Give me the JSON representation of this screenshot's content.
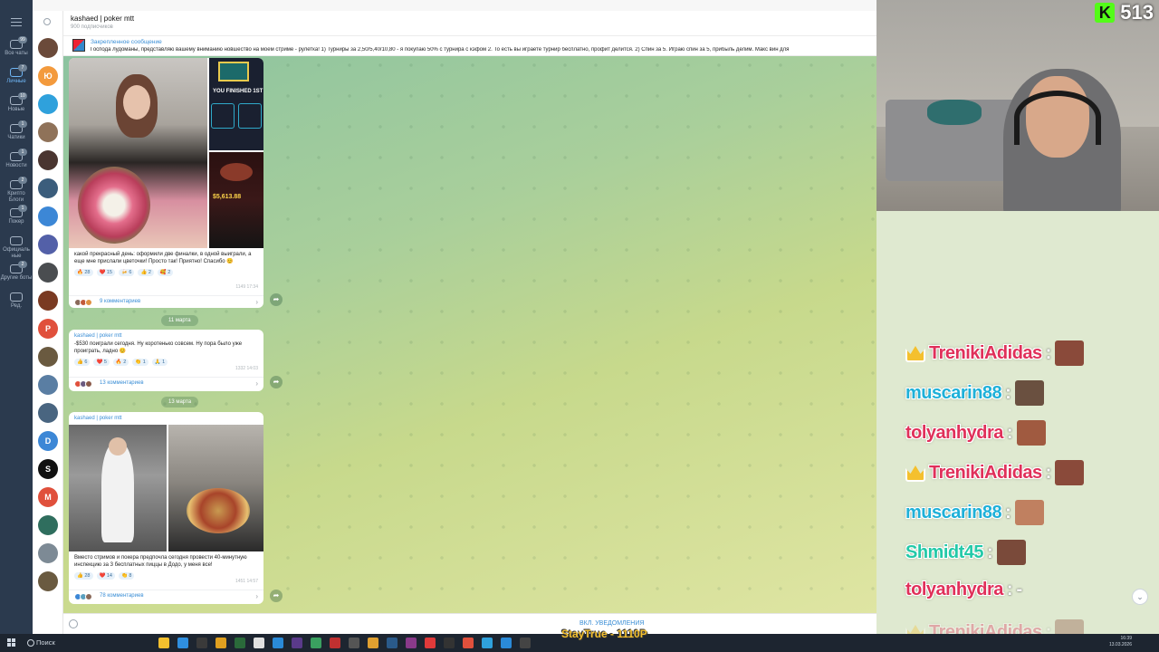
{
  "folders": {
    "items": [
      {
        "label": "Все чаты",
        "badge": "99"
      },
      {
        "label": "Личные",
        "badge": "7"
      },
      {
        "label": "Новые",
        "badge": "10"
      },
      {
        "label": "Чатики",
        "badge": "1"
      },
      {
        "label": "Новости",
        "badge": "1"
      },
      {
        "label": "Крипто Блоги",
        "badge": "2"
      },
      {
        "label": "Покер",
        "badge": "1"
      },
      {
        "label": "Официаль ные",
        "badge": ""
      },
      {
        "label": "Другие боты",
        "badge": "2"
      },
      {
        "label": "Ред.",
        "badge": ""
      }
    ]
  },
  "chatlist": {
    "avatars": [
      {
        "letter": "",
        "color": "#6b4a3a"
      },
      {
        "letter": "Ю",
        "color": "#f39a3d"
      },
      {
        "letter": "",
        "color": "#2fa1dc"
      },
      {
        "letter": "",
        "color": "#8f7259"
      },
      {
        "letter": "",
        "color": "#4a3530"
      },
      {
        "letter": "",
        "color": "#3b5d7c"
      },
      {
        "letter": "",
        "color": "#3c87d6"
      },
      {
        "letter": "",
        "color": "#5360a8"
      },
      {
        "letter": "",
        "color": "#4a4d50"
      },
      {
        "letter": "",
        "color": "#7a3a22"
      },
      {
        "letter": "P",
        "color": "#e0503c"
      },
      {
        "letter": "",
        "color": "#6a5a40"
      },
      {
        "letter": "",
        "color": "#5a7ea3"
      },
      {
        "letter": "",
        "color": "#496580"
      },
      {
        "letter": "D",
        "color": "#3c87d6"
      },
      {
        "letter": "S",
        "color": "#111111"
      },
      {
        "letter": "M",
        "color": "#e0503c"
      },
      {
        "letter": "",
        "color": "#2f6e5e"
      },
      {
        "letter": "",
        "color": "#7d8a95"
      },
      {
        "letter": "",
        "color": "#6a5a40"
      }
    ]
  },
  "header": {
    "title": "kashaed | poker mtt",
    "subscribers": "900 подписчиков"
  },
  "pinned": {
    "label": "Закрепленное сообщение",
    "text": "Господа лудоманы, представляю вашему вниманию новшество на моем стриме - рулетка! 1) Турниры за 2,50/5,40/10,80 - я покупаю 50% с турнира с кэфом 2. То есть вы играете турнир бесплатно, профит делится. 2) Спин за 5. Играю спин за 5, прибыль делим. Макс вин для"
  },
  "messages": [
    {
      "author": "",
      "text": "какой прекрасный день: оформили две финалки, в одной выиграли, а еще мне прислали цветочки! Просто так! Приятно! Спасибо 😊",
      "reactions": [
        "🔥 28",
        "❤️ 15",
        "🍻 6",
        "👍 2",
        "🥰 2"
      ],
      "views": "1149  17:34",
      "comments": "9 комментариев",
      "poster_title": "YOU FINISHED 1ST",
      "poster_amount": "$5,613.88"
    },
    {
      "author": "kashaed | poker mtt",
      "text": "-$530 поиграли сегодня. Ну коротенько совсем. Ну пора было уже проиграть, ладно 😊",
      "reactions": [
        "👍 6",
        "❤️ 5",
        "🔥 2",
        "👏 1",
        "🙏 1"
      ],
      "views": "1332  14:03",
      "comments": "13 комментариев"
    },
    {
      "author": "kashaed | poker mtt",
      "text": "Вместо стримов и покера предпочла сегодня провести 40-минутную инспекцию за 3 бесплатных пиццы в Додо, у меня все!",
      "reactions": [
        "👍 28",
        "❤️ 14",
        "👏 8"
      ],
      "views": "1451  14:57",
      "comments": "78 комментариев"
    }
  ],
  "dates": [
    "11 марта",
    "13 марта"
  ],
  "composer": {
    "notif_label": "ВКЛ. УВЕДОМЛЕНИЯ"
  },
  "kick": {
    "count": "513"
  },
  "stream_chat": [
    {
      "name": "TrenikiAdidas",
      "color": "#e0305a",
      "crown": true,
      "emote_color": "#8a4a3a",
      "text": ""
    },
    {
      "name": "muscarin88",
      "color": "#1eb0d8",
      "crown": false,
      "emote_color": "#6a5040",
      "text": ""
    },
    {
      "name": "tolyanhydra",
      "color": "#e0305a",
      "crown": false,
      "emote_color": "#a05a40",
      "text": ""
    },
    {
      "name": "TrenikiAdidas",
      "color": "#e0305a",
      "crown": true,
      "emote_color": "#8a4a3a",
      "text": ""
    },
    {
      "name": "muscarin88",
      "color": "#1eb0d8",
      "crown": false,
      "emote_color": "#c08060",
      "text": ""
    },
    {
      "name": "Shmidt45",
      "color": "#23c9a8",
      "crown": false,
      "emote_color": "#7a4a3a",
      "text": ""
    },
    {
      "name": "tolyanhydra",
      "color": "#e0305a",
      "crown": false,
      "emote_color": "",
      "text": "-"
    },
    {
      "name": "TrenikiAdidas",
      "color": "#e0305a",
      "crown": true,
      "emote_color": "#8a4a3a",
      "text": ""
    }
  ],
  "taskbar": {
    "search_label": "Поиск",
    "streamer_tag": "StayTrue - 1110P",
    "time": "16:39",
    "date": "13.03.2026"
  }
}
